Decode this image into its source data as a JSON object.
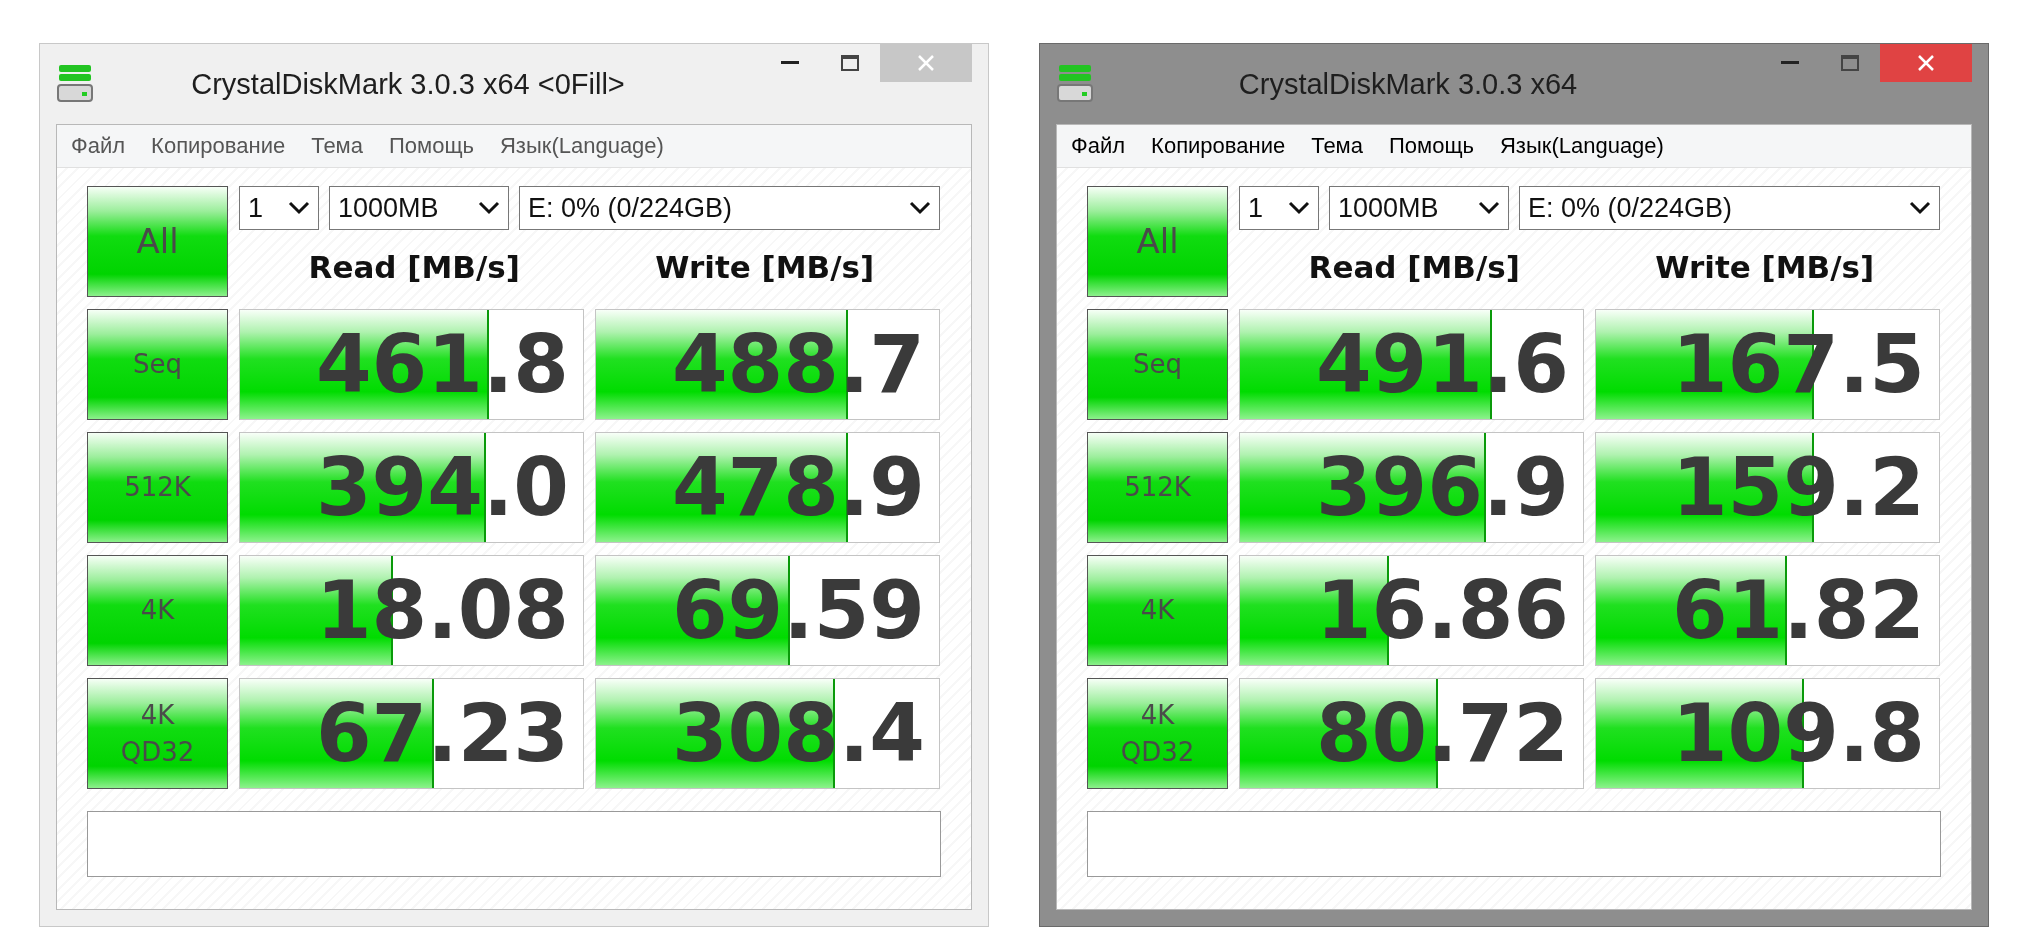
{
  "windows": [
    {
      "title": "CrystalDiskMark 3.0.3 x64 <0Fill>",
      "active": false,
      "menu": [
        "Файл",
        "Копирование",
        "Тема",
        "Помощь",
        "Язык(Language)"
      ],
      "all_button": "All",
      "selects": [
        "1",
        "1000MB",
        "E: 0% (0/224GB)"
      ],
      "headers": [
        "Read [MB/s]",
        "Write [MB/s]"
      ],
      "rows": [
        {
          "label": "Seq",
          "read": {
            "value": "461.8",
            "level": 0.72
          },
          "write": {
            "value": "488.7",
            "level": 0.73
          }
        },
        {
          "label": "512K",
          "read": {
            "value": "394.0",
            "level": 0.71
          },
          "write": {
            "value": "478.9",
            "level": 0.73
          }
        },
        {
          "label": "4K",
          "read": {
            "value": "18.08",
            "level": 0.44
          },
          "write": {
            "value": "69.59",
            "level": 0.56
          }
        },
        {
          "label": "4K\nQD32",
          "read": {
            "value": "67.23",
            "level": 0.56
          },
          "write": {
            "value": "308.4",
            "level": 0.69
          }
        }
      ]
    },
    {
      "title": "CrystalDiskMark 3.0.3 x64",
      "active": true,
      "menu": [
        "Файл",
        "Копирование",
        "Тема",
        "Помощь",
        "Язык(Language)"
      ],
      "all_button": "All",
      "selects": [
        "1",
        "1000MB",
        "E: 0% (0/224GB)"
      ],
      "headers": [
        "Read [MB/s]",
        "Write [MB/s]"
      ],
      "rows": [
        {
          "label": "Seq",
          "read": {
            "value": "491.6",
            "level": 0.73
          },
          "write": {
            "value": "167.5",
            "level": 0.63
          }
        },
        {
          "label": "512K",
          "read": {
            "value": "396.9",
            "level": 0.71
          },
          "write": {
            "value": "159.2",
            "level": 0.63
          }
        },
        {
          "label": "4K",
          "read": {
            "value": "16.86",
            "level": 0.43
          },
          "write": {
            "value": "61.82",
            "level": 0.55
          }
        },
        {
          "label": "4K\nQD32",
          "read": {
            "value": "80.72",
            "level": 0.57
          },
          "write": {
            "value": "109.8",
            "level": 0.6
          }
        }
      ]
    }
  ]
}
